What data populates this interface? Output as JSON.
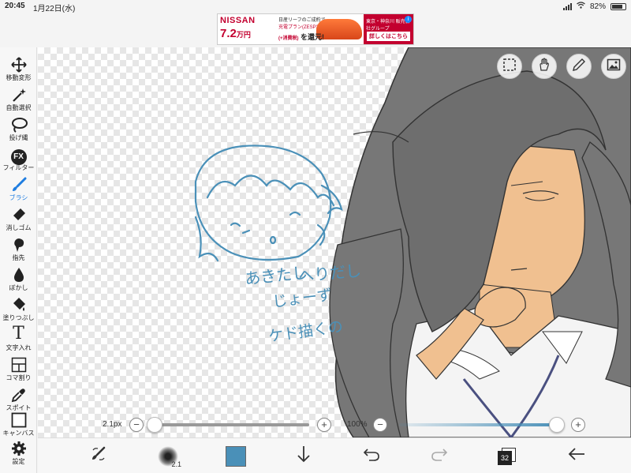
{
  "status_bar": {
    "time": "20:45",
    "date": "1月22日(水)",
    "battery": "82%",
    "battery_level": 0.82
  },
  "ad": {
    "brand": "NISSAN",
    "headline": "日産リーフのご成約で",
    "subline": "充電プラン(ZESP3)ご加入時に",
    "price": "7.2",
    "price_unit": "万円",
    "tax": "(+消費税)",
    "tag": "を還元!",
    "dealer": "東京・神奈川 販売会社グループ",
    "cta": "詳しくはこちら",
    "info": "i"
  },
  "tools": [
    {
      "icon": "move-transform-icon",
      "label": "移動変形"
    },
    {
      "icon": "magic-wand-icon",
      "label": "自動選択"
    },
    {
      "icon": "lasso-icon",
      "label": "投げ縄"
    },
    {
      "icon": "fx-icon",
      "label": "フィルター",
      "glyph": "FX"
    },
    {
      "icon": "brush-icon",
      "label": "ブラシ",
      "active": true
    },
    {
      "icon": "eraser-icon",
      "label": "消しゴム"
    },
    {
      "icon": "smudge-icon",
      "label": "指先"
    },
    {
      "icon": "blur-drop-icon",
      "label": "ぼかし"
    },
    {
      "icon": "fill-bucket-icon",
      "label": "塗りつぶし"
    },
    {
      "icon": "text-icon",
      "label": "文字入れ",
      "glyph": "T"
    },
    {
      "icon": "frame-divide-icon",
      "label": "コマ割り"
    },
    {
      "icon": "eyedropper-icon",
      "label": "スポイト"
    },
    {
      "icon": "canvas-icon",
      "label": "キャンバス"
    },
    {
      "icon": "settings-gear-icon",
      "label": "設定"
    }
  ],
  "canvas": {
    "sketch_text": [
      "あきたし",
      "へりだし",
      "じょーず",
      "ケド描くの"
    ]
  },
  "sliders": {
    "brush_size_label": "2.1px",
    "brush_size_fraction": 0.0,
    "opacity_label": "100%",
    "opacity_fraction": 1.0,
    "minus": "−",
    "plus": "+"
  },
  "bottom_bar": {
    "brush_size_preview": "2.1",
    "current_color": "#4a90b8",
    "layer_count": "32"
  },
  "colors": {
    "accent": "#1f7de0",
    "sketch_blue": "#4a90b8",
    "skin": "#f0c090",
    "hair": "#7a7a7a"
  }
}
